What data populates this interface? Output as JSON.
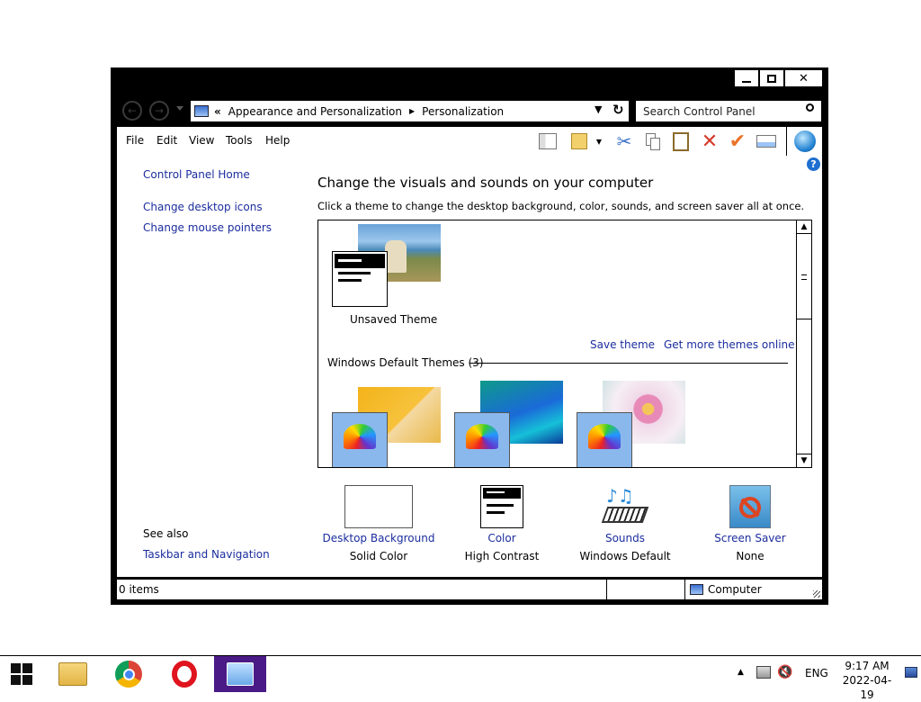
{
  "window": {
    "minimize": "—",
    "maximize": "☐",
    "close": "✕"
  },
  "nav": {
    "breadcrumb_prefix": "«",
    "crumb1": "Appearance and Personalization",
    "crumb2": "Personalization",
    "search_placeholder": "Search Control Panel"
  },
  "menubar": {
    "items": [
      "File",
      "Edit",
      "View",
      "Tools",
      "Help"
    ]
  },
  "sidebar": {
    "home": "Control Panel Home",
    "links": [
      "Change desktop icons",
      "Change mouse pointers"
    ],
    "see_also": "See also",
    "see_also_links": [
      "Taskbar and Navigation"
    ]
  },
  "main": {
    "heading": "Change the visuals and sounds on your computer",
    "subtitle": "Click a theme to change the desktop background, color, sounds, and screen saver all at once.",
    "unsaved_theme": "Unsaved Theme",
    "save_theme": "Save theme",
    "get_more": "Get more themes online",
    "group_label": "Windows Default Themes (3)"
  },
  "bottom": [
    {
      "label": "Desktop Background",
      "value": "Solid Color"
    },
    {
      "label": "Color",
      "value": "High Contrast"
    },
    {
      "label": "Sounds",
      "value": "Windows Default"
    },
    {
      "label": "Screen Saver",
      "value": "None"
    }
  ],
  "status": {
    "items": "0 items",
    "location": "Computer"
  },
  "taskbar": {
    "lang": "ENG",
    "time": "9:17 AM",
    "date": "2022-04-19"
  },
  "colors": {
    "link": "#1b2d9e",
    "window_frame": "#000000",
    "taskbar_active": "#4a1a86"
  },
  "icons": [
    "back-arrow-icon",
    "forward-arrow-icon",
    "computer-icon",
    "refresh-icon",
    "search-icon",
    "help-icon",
    "scissors-icon",
    "copy-icon",
    "paste-icon",
    "delete-icon",
    "checkmark-icon",
    "windows-logo-icon",
    "file-explorer-icon",
    "chrome-icon",
    "opera-icon",
    "control-panel-icon"
  ]
}
